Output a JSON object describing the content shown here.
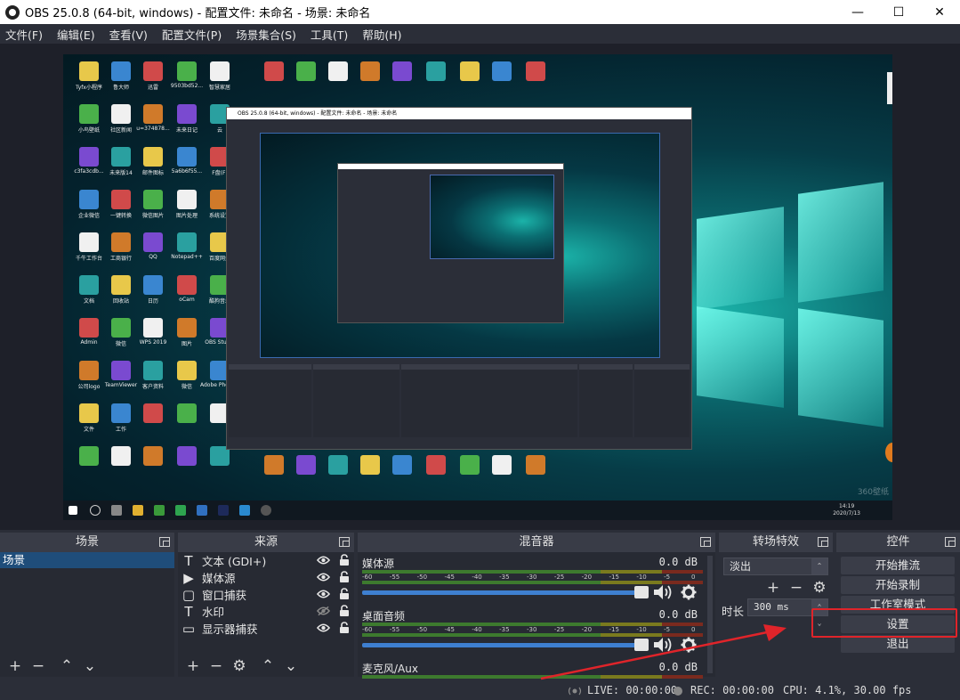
{
  "window": {
    "title": "OBS 25.0.8 (64-bit, windows) - 配置文件: 未命名 - 场景: 未命名",
    "controls": {
      "minimize": "—",
      "maximize": "☐",
      "close": "✕"
    }
  },
  "menu": [
    "文件(F)",
    "编辑(E)",
    "查看(V)",
    "配置文件(P)",
    "场景集合(S)",
    "工具(T)",
    "帮助(H)"
  ],
  "preview": {
    "nested_title": "OBS 25.0.8 (64-bit, windows) - 配置文件: 未命名 - 场景: 未命名",
    "desktop_icons": [
      "Tyfx小程序",
      "鲁大师",
      "迅雷",
      "9503bd52...",
      "智慧家居",
      "小鸟壁纸",
      "社区新闻",
      "u=374878...",
      "未来日记",
      "云",
      "c3fa3cdb...",
      "未来版14",
      "邮件图标",
      "5a6b6f55...",
      "F盘(F)",
      "企业微信",
      "一键转换",
      "微信图片",
      "图片处理",
      "系统设置",
      "千牛工作台",
      "工商银行",
      "QQ",
      "Notepad++",
      "百度网盘",
      "文档",
      "回收站",
      "日历",
      "oCam",
      "酷狗音乐",
      "Admin",
      "微信",
      "WPS 2019",
      "图片",
      "OBS Studio",
      "公司logo",
      "TeamViewer",
      "客户资料",
      "微信",
      "Adobe Photosh...",
      "文件",
      "工作"
    ],
    "watermark": "360壁纸",
    "clock_time": "14:19",
    "clock_date": "2020/7/13"
  },
  "docks": {
    "scenes": {
      "title": "场景",
      "items": [
        "场景"
      ],
      "toolbar": [
        "+",
        "−",
        "⌃",
        "⌄"
      ]
    },
    "sources": {
      "title": "来源",
      "items": [
        {
          "icon": "text-icon",
          "glyph": "T",
          "label": "文本 (GDI+)"
        },
        {
          "icon": "media-play-icon",
          "glyph": "▶",
          "label": "媒体源"
        },
        {
          "icon": "window-capture-icon",
          "glyph": "▢",
          "label": "窗口捕获"
        },
        {
          "icon": "text-icon",
          "glyph": "T",
          "label": "水印"
        },
        {
          "icon": "monitor-icon",
          "glyph": "▭",
          "label": "显示器捕获"
        }
      ],
      "toolbar": [
        "+",
        "−",
        "⚙",
        "⌃",
        "⌄"
      ]
    },
    "mixer": {
      "title": "混音器",
      "ticks": [
        "-60",
        "-55",
        "-50",
        "-45",
        "-40",
        "-35",
        "-30",
        "-25",
        "-20",
        "-15",
        "-10",
        "-5",
        "0"
      ],
      "channels": [
        {
          "name": "媒体源",
          "db": "0.0 dB"
        },
        {
          "name": "桌面音频",
          "db": "0.0 dB"
        },
        {
          "name": "麦克风/Aux",
          "db": "0.0 dB"
        }
      ]
    },
    "transitions": {
      "title": "转场特效",
      "selected": "淡出",
      "toolbar": [
        "+",
        "−",
        "⚙"
      ],
      "duration_label": "时长",
      "duration_value": "300 ms"
    },
    "controls": {
      "title": "控件",
      "buttons": [
        "开始推流",
        "开始录制",
        "工作室模式",
        "设置",
        "退出"
      ]
    }
  },
  "status": {
    "live": "LIVE: 00:00:00",
    "rec": "REC: 00:00:00",
    "cpu": "CPU: 4.1%, 30.00 fps"
  },
  "colors": {
    "background": "#2b2e38",
    "dock_header": "#393c47",
    "selected_scene": "#1f4d7a",
    "annotation": "#e0242a",
    "slider": "#3e7fd0"
  }
}
